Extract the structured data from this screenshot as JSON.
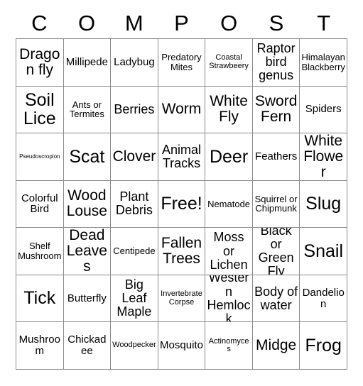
{
  "card": {
    "header_letters": [
      "C",
      "O",
      "M",
      "P",
      "O",
      "S",
      "T"
    ],
    "columns": 7,
    "rows": 7,
    "free_space_label": "Free!",
    "grid_line_color": "#8a8a8a",
    "background_color": "#ffffff",
    "text_color": "#000000",
    "cells": [
      [
        {
          "text": "Dragon fly",
          "size": "xl"
        },
        {
          "text": "Millipede",
          "size": "m"
        },
        {
          "text": "Ladybug",
          "size": "m"
        },
        {
          "text": "Predatory Mites",
          "size": "s"
        },
        {
          "text": "Coastal Strawbeery",
          "size": "xs"
        },
        {
          "text": "Raptor bird genus",
          "size": "l"
        },
        {
          "text": "Himalayan Blackberry",
          "size": "s"
        }
      ],
      [
        {
          "text": "Soil Lice",
          "size": "xxl"
        },
        {
          "text": "Ants or Termites",
          "size": "s"
        },
        {
          "text": "Berries",
          "size": "l"
        },
        {
          "text": "Worm",
          "size": "xl"
        },
        {
          "text": "White Fly",
          "size": "xl"
        },
        {
          "text": "Sword Fern",
          "size": "xl"
        },
        {
          "text": "Spiders",
          "size": "m"
        }
      ],
      [
        {
          "text": "Pseudoscropion",
          "size": "xxs"
        },
        {
          "text": "Scat",
          "size": "xxl"
        },
        {
          "text": "Clover",
          "size": "xl"
        },
        {
          "text": "Animal Tracks",
          "size": "l"
        },
        {
          "text": "Deer",
          "size": "xxl"
        },
        {
          "text": "Feathers",
          "size": "m"
        },
        {
          "text": "White Flower",
          "size": "xl"
        }
      ],
      [
        {
          "text": "Colorful Bird",
          "size": "m"
        },
        {
          "text": "Wood Louse",
          "size": "xl"
        },
        {
          "text": "Plant Debris",
          "size": "l"
        },
        {
          "text": "Free!",
          "size": "xxl"
        },
        {
          "text": "Nematode",
          "size": "s"
        },
        {
          "text": "Squirrel or Chipmunk",
          "size": "s"
        },
        {
          "text": "Slug",
          "size": "xxl"
        }
      ],
      [
        {
          "text": "Shelf Mushroom",
          "size": "s"
        },
        {
          "text": "Dead Leaves",
          "size": "xl"
        },
        {
          "text": "Centipede",
          "size": "s"
        },
        {
          "text": "Fallen Trees",
          "size": "xl"
        },
        {
          "text": "Moss or Lichen",
          "size": "l"
        },
        {
          "text": "Black or Green Fly",
          "size": "l"
        },
        {
          "text": "Snail",
          "size": "xxl"
        }
      ],
      [
        {
          "text": "Tick",
          "size": "xxl"
        },
        {
          "text": "Butterfly",
          "size": "m"
        },
        {
          "text": "Big Leaf Maple",
          "size": "l"
        },
        {
          "text": "Invertebrate Corpse",
          "size": "xs"
        },
        {
          "text": "Western Hemlock",
          "size": "l"
        },
        {
          "text": "Body of water",
          "size": "l"
        },
        {
          "text": "Dandelion",
          "size": "m"
        }
      ],
      [
        {
          "text": "Mushroom",
          "size": "m"
        },
        {
          "text": "Chickadee",
          "size": "m"
        },
        {
          "text": "Woodpecker",
          "size": "xs"
        },
        {
          "text": "Mosquito",
          "size": "m"
        },
        {
          "text": "Actinomyces",
          "size": "xs"
        },
        {
          "text": "Midge",
          "size": "xl"
        },
        {
          "text": "Frog",
          "size": "xxl"
        }
      ]
    ]
  }
}
